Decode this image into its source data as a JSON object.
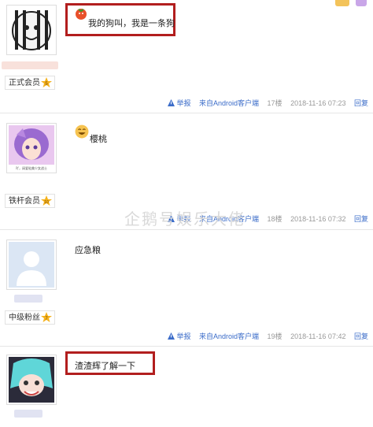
{
  "posts": [
    {
      "content": "我的狗叫，我是一条狗",
      "rank": "正式会员",
      "report": "举报",
      "source": "来自Android客户端",
      "floor": "17楼",
      "time": "2018-11-16 07:23",
      "reply": "回复"
    },
    {
      "content": "樱桃",
      "rank": "铁杆会员",
      "avatar_caption": "吖，阔爱哒美少女战士",
      "report": "举报",
      "source": "来自Android客户端",
      "floor": "18楼",
      "time": "2018-11-16 07:32",
      "reply": "回复"
    },
    {
      "content": "应急粮",
      "rank": "中级粉丝",
      "report": "举报",
      "source": "来自Android客户端",
      "floor": "19楼",
      "time": "2018-11-16 07:42",
      "reply": "回复"
    },
    {
      "content": "渣渣辉了解一下"
    }
  ],
  "watermark": "企鹅号娱乐大佬",
  "colors": {
    "highlight_box": "#b21e1e",
    "link": "#3b6cc9",
    "meta": "#999999"
  },
  "icons": [
    "tomato-emoji-icon",
    "grin-emoji-icon",
    "warning-icon",
    "rank-star-icon"
  ]
}
